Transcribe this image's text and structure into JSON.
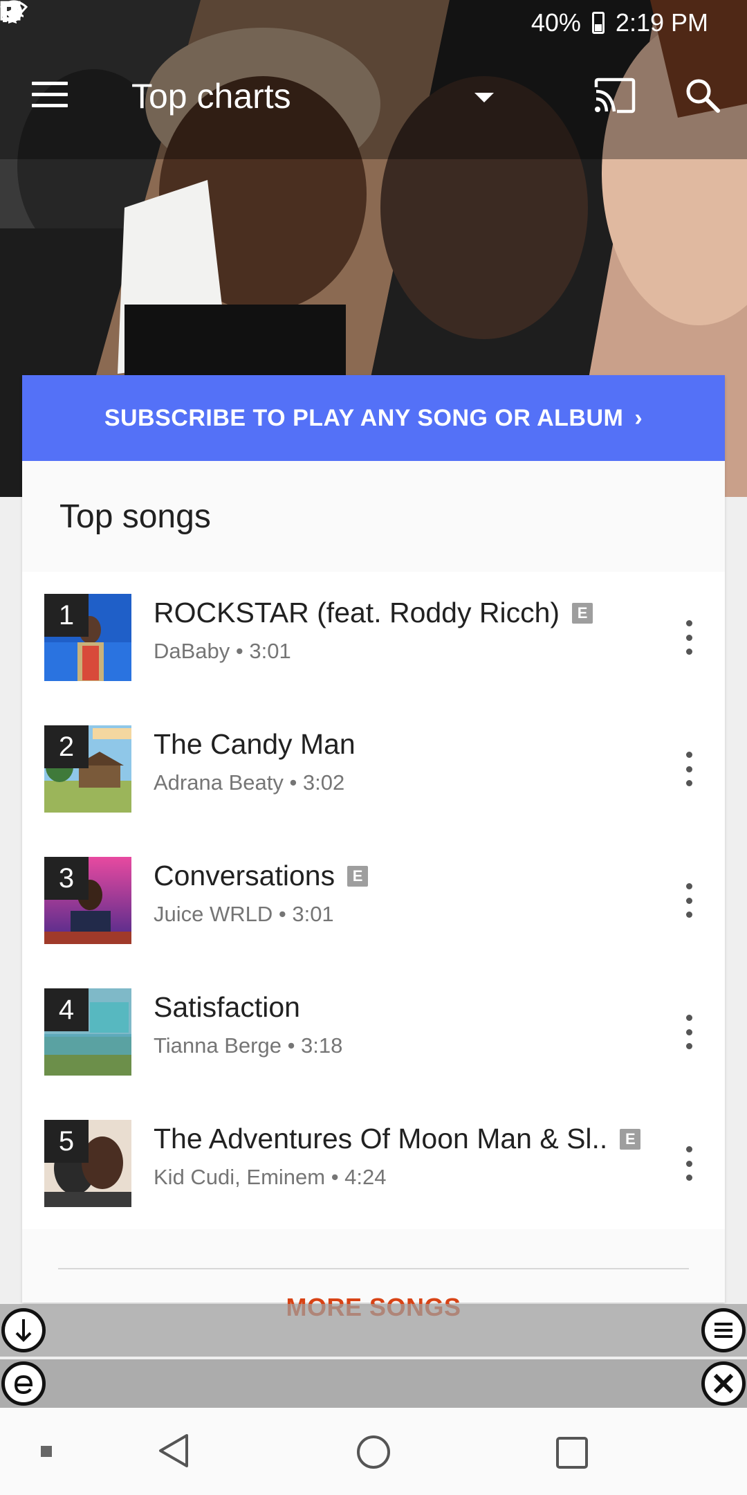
{
  "status_bar": {
    "time": "2:19 PM",
    "battery": "40%",
    "left_icons": [
      "image-icon",
      "pinwheel-icon",
      "app-icon",
      "app-icon",
      "calendar-icon",
      "usb-icon",
      "p-icon"
    ],
    "right_icons": [
      "wifi-icon",
      "airplane-icon",
      "battery-icon"
    ]
  },
  "app_bar": {
    "title": "Top charts",
    "icons": [
      "menu-icon",
      "dropdown-icon",
      "cast-icon",
      "search-icon"
    ]
  },
  "banner": {
    "label": "SUBSCRIBE TO PLAY ANY SONG OR ALBUM",
    "color": "#5471f7"
  },
  "section": {
    "title": "Top songs"
  },
  "songs": [
    {
      "rank": "1",
      "title": "ROCKSTAR (feat. Roddy Ricch)",
      "explicit": "E",
      "subtitle": "DaBaby • 3:01"
    },
    {
      "rank": "2",
      "title": "The Candy Man",
      "explicit": "",
      "subtitle": "Adrana Beaty • 3:02"
    },
    {
      "rank": "3",
      "title": "Conversations",
      "explicit": "E",
      "subtitle": "Juice WRLD • 3:01"
    },
    {
      "rank": "4",
      "title": "Satisfaction",
      "explicit": "",
      "subtitle": "Tianna Berge • 3:18"
    },
    {
      "rank": "5",
      "title": "The Adventures Of Moon Man & Sl..",
      "explicit": "E",
      "subtitle": "Kid Cudi, Eminem • 4:24"
    }
  ],
  "more_songs": {
    "label": "MORE SONGS",
    "color": "#d84315"
  },
  "overlay": {
    "icons": [
      "scroll-down-icon",
      "list-icon",
      "e-icon",
      "close-icon"
    ]
  },
  "nav_bar": {
    "icons": [
      "dot-icon",
      "back-icon",
      "home-icon",
      "recents-icon"
    ]
  }
}
